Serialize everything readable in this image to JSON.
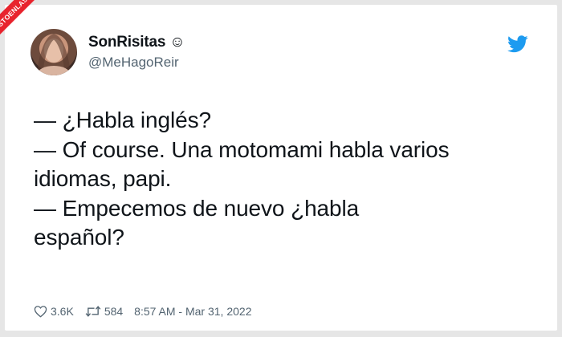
{
  "watermark": {
    "text": "VISTOENLASREDES"
  },
  "tweet": {
    "display_name": "SonRisitas ☺",
    "handle": "@MeHagoReir",
    "text": "— ¿Habla inglés?\n— Of course. Una motomami habla varios\nidiomas, papi.\n— Empecemos de nuevo ¿habla\nespañol?",
    "likes": "3.6K",
    "retweets": "584",
    "timestamp": "8:57 AM - Mar 31, 2022"
  },
  "icons": {
    "logo": "twitter-bird-icon",
    "like": "heart-icon",
    "retweet": "retweet-icon"
  },
  "colors": {
    "brand": "#1d9bf0",
    "watermark": "#e8232d",
    "text": "#0f1419",
    "muted": "#536471"
  }
}
